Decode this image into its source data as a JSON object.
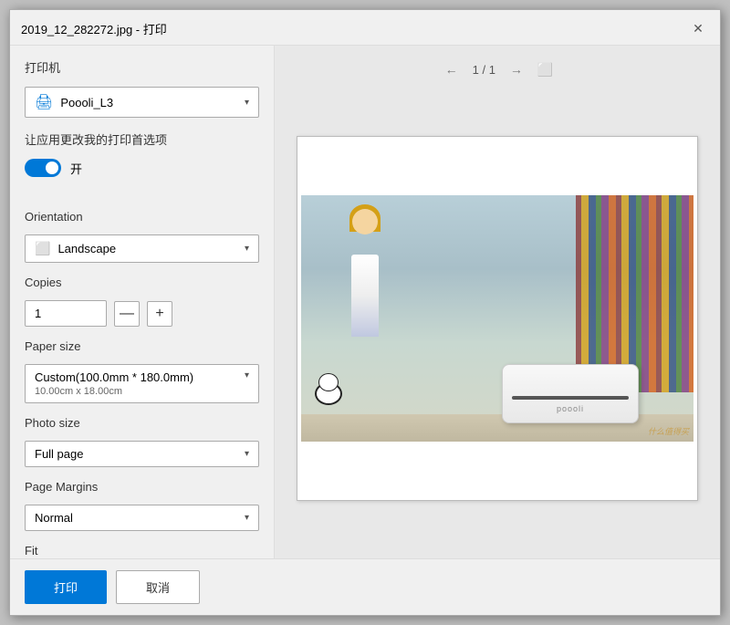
{
  "dialog": {
    "title": "2019_12_282272.jpg - 打印",
    "close_label": "✕"
  },
  "left": {
    "printer_section_label": "打印机",
    "printer_name": "Poooli_L3",
    "toggle_label": "让应用更改我的打印首选项",
    "toggle_state": "开",
    "orientation_label": "Orientation",
    "orientation_value": "Landscape",
    "copies_label": "Copies",
    "copies_value": "1",
    "copies_decrement": "—",
    "copies_increment": "+",
    "paper_size_label": "Paper size",
    "paper_size_value": "Custom(100.0mm * 180.0mm)",
    "paper_size_sub": "10.00cm x 18.00cm",
    "photo_size_label": "Photo size",
    "photo_size_value": "Full page",
    "page_margins_label": "Page Margins",
    "page_margins_value": "Normal",
    "fit_label": "Fit"
  },
  "footer": {
    "print_label": "打印",
    "cancel_label": "取消"
  },
  "preview": {
    "page_indicator": "1 / 1",
    "prev_arrow": "←",
    "next_arrow": "→"
  }
}
